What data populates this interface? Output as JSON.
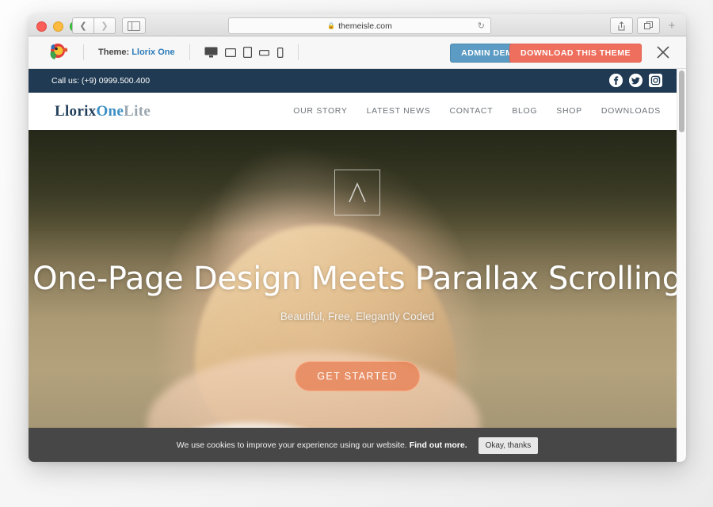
{
  "browser": {
    "url": "themeisle.com",
    "lock_icon": "lock-icon",
    "reload_icon": "reload-icon",
    "back_icon": "chevron-left-icon",
    "forward_icon": "chevron-right-icon",
    "sidebar_icon": "sidebar-icon",
    "share_icon": "share-icon",
    "tabs_icon": "tabs-icon",
    "newtab_icon": "plus-icon"
  },
  "preview_toolbar": {
    "brand_logo": "themeisle-parrot-logo",
    "theme_prefix": "Theme:",
    "theme_name": "Llorix One",
    "devices": [
      {
        "name": "desktop-preview",
        "icon": "monitor-icon"
      },
      {
        "name": "tablet-landscape-preview",
        "icon": "tablet-landscape-icon"
      },
      {
        "name": "tablet-portrait-preview",
        "icon": "tablet-portrait-icon"
      },
      {
        "name": "phone-landscape-preview",
        "icon": "phone-landscape-icon"
      },
      {
        "name": "phone-portrait-preview",
        "icon": "phone-portrait-icon"
      }
    ],
    "admin_demo_label": "ADMIN DEMO",
    "download_label": "DOWNLOAD THIS THEME",
    "close_icon": "close-icon",
    "admin_color": "#5b9bc4",
    "download_color": "#ef6f5e"
  },
  "site": {
    "topbar": {
      "phone_text": "Call us: (+9) 0999.500.400",
      "background": "#1f3a52",
      "socials": [
        {
          "name": "facebook-icon",
          "glyph": "f"
        },
        {
          "name": "twitter-icon",
          "glyph": "t"
        },
        {
          "name": "instagram-icon",
          "glyph": "i"
        }
      ]
    },
    "logo": {
      "part1": "Llorix",
      "part2": "One",
      "part3": "Lite",
      "accent": "#3b8fc4"
    },
    "nav": [
      {
        "label": "OUR STORY"
      },
      {
        "label": "LATEST NEWS"
      },
      {
        "label": "CONTACT"
      },
      {
        "label": "BLOG"
      },
      {
        "label": "SHOP"
      },
      {
        "label": "DOWNLOADS"
      }
    ],
    "hero": {
      "emblem_icon": "lambda-emblem-icon",
      "heading": "One-Page Design Meets Parallax Scrolling",
      "subheading": "Beautiful, Free, Elegantly Coded",
      "cta_label": "GET STARTED",
      "cta_color": "#e77a4e",
      "widget_icon": "chat-widget-icon"
    },
    "cookie_notice": {
      "text": "We use cookies to improve your experience using our website.",
      "link_label": "Find out more.",
      "button_label": "Okay, thanks",
      "background": "#474747"
    }
  }
}
